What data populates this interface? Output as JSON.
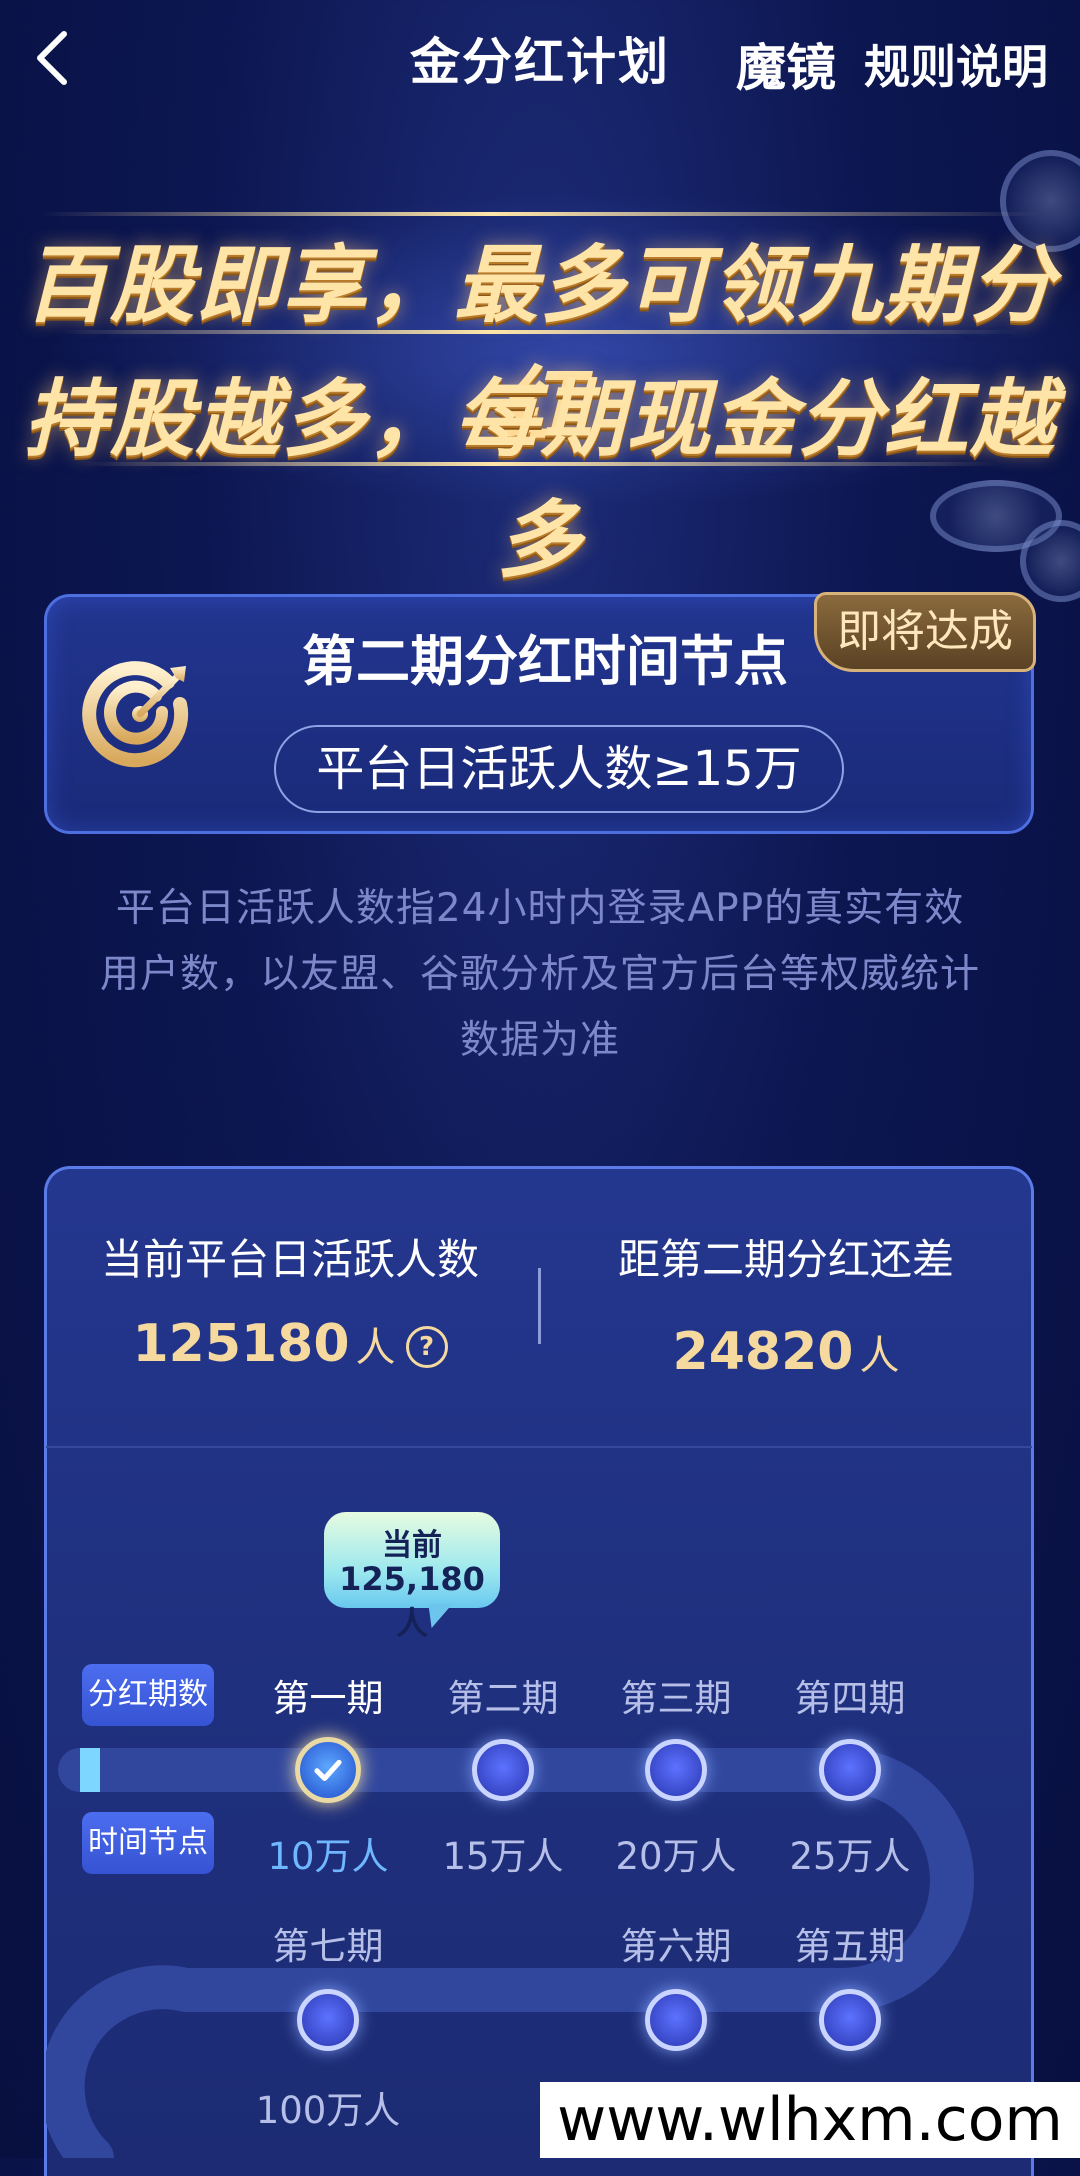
{
  "header": {
    "title": "金分红计划",
    "brand": "魔镜",
    "rules_link": "规则说明"
  },
  "banner": {
    "line1": "百股即享，最多可领九期分红",
    "line2": "持股越多，每期现金分红越多"
  },
  "milestone": {
    "title": "第二期分红时间节点",
    "badge": "即将达成",
    "condition": "平台日活跃人数≥15万"
  },
  "description": [
    "平台日活跃人数指24小时内登录APP的真实有效",
    "用户数，以友盟、谷歌分析及官方后台等权威统计",
    "数据为准"
  ],
  "stats": {
    "current": {
      "label": "当前平台日活跃人数",
      "value": "125180",
      "unit": "人",
      "help": "?"
    },
    "remaining": {
      "label": "距第二期分红还差",
      "value": "24820",
      "unit": "人"
    }
  },
  "progress": {
    "tooltip_title": "当前",
    "tooltip_value": "125,180 人",
    "tag_periods": "分红期数",
    "tag_nodes": "时间节点",
    "row1": [
      {
        "period": "第一期",
        "threshold": "10万人",
        "state": "done"
      },
      {
        "period": "第二期",
        "threshold": "15万人",
        "state": "pending"
      },
      {
        "period": "第三期",
        "threshold": "20万人",
        "state": "pending"
      },
      {
        "period": "第四期",
        "threshold": "25万人",
        "state": "pending"
      }
    ],
    "row2": [
      {
        "period": "第七期",
        "threshold": "100万人",
        "state": "pending"
      },
      {
        "period": "第六期",
        "threshold": "",
        "state": "pending"
      },
      {
        "period": "第五期",
        "threshold": "",
        "state": "pending"
      }
    ]
  },
  "watermark": "www.wlhxm.com",
  "colors": {
    "background": "#0c1650",
    "gold": "#f5d99e",
    "accent_blue": "#6fb7ff",
    "card_border": "#4d6fe0"
  },
  "icons": [
    "back-arrow-icon",
    "target-icon",
    "help-icon",
    "check-icon"
  ]
}
